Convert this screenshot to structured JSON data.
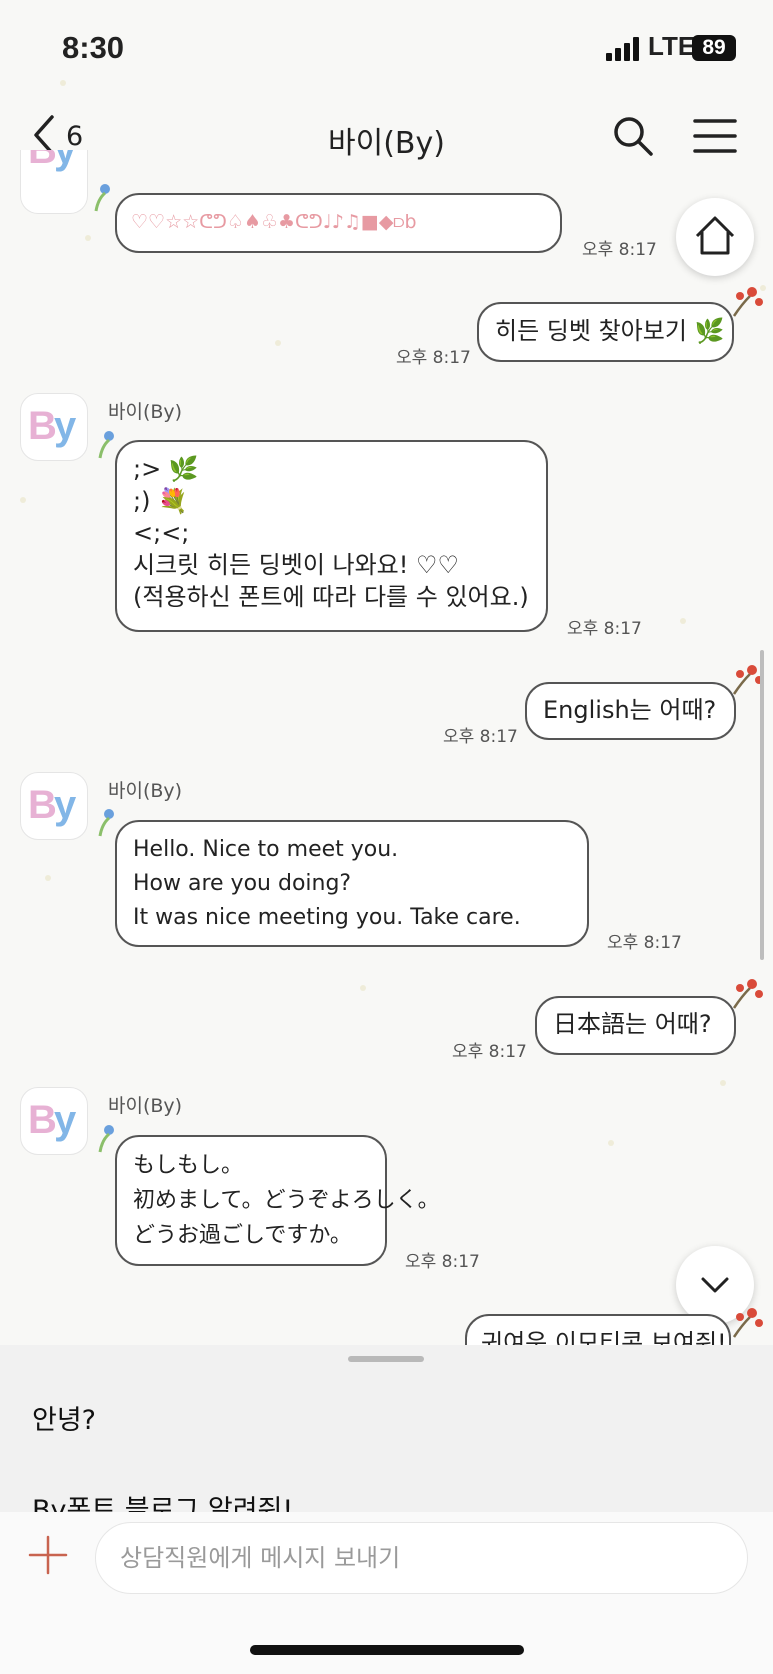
{
  "status_bar": {
    "time": "8:30",
    "network": "LTE",
    "battery": "89"
  },
  "header": {
    "back_count": "6",
    "title": "바이(By)"
  },
  "messages": [
    {
      "side": "left",
      "text": "♡♡☆☆ᕦᕤ♤♠♧♣ᕦᕤ♩♪♫■◆⫐b",
      "time": "오후 8:17"
    },
    {
      "side": "right",
      "text": "히든 딩벳 찾아보기 🌿",
      "time": "오후 8:17"
    },
    {
      "side": "left",
      "sender": "바이(By)",
      "text": ";> 🌿\n;) 💐\n<;<;\n시크릿 히든 딩벳이 나와요! ♡♡\n(적용하신 폰트에 따라 다를 수 있어요.)",
      "time": "오후 8:17"
    },
    {
      "side": "right",
      "text": "English는 어때?",
      "time": "오후 8:17"
    },
    {
      "side": "left",
      "sender": "바이(By)",
      "text": "Hello. Nice to meet you.\nHow are you doing?\nIt was nice meeting you. Take care.",
      "time": "오후 8:17"
    },
    {
      "side": "right",
      "text": "日本語는 어때?",
      "time": "오후 8:17"
    },
    {
      "side": "left",
      "sender": "바이(By)",
      "text": "もしもし。\n初めまして。どうぞよろしく。\nどうお過ごしですか。",
      "time": "오후 8:17"
    },
    {
      "side": "right",
      "text": "귀여운 이모티콘 보여줘!",
      "time": ""
    }
  ],
  "avatar_label": "By",
  "suggestions": [
    "안녕?",
    "By폰트 블로그 알려줘!"
  ],
  "input": {
    "placeholder": "상담직원에게 메시지 보내기"
  },
  "icons": {
    "back": "chevron-left-icon",
    "search": "search-icon",
    "menu": "hamburger-icon",
    "home": "home-icon",
    "down": "chevron-down-icon",
    "plus": "plus-icon"
  },
  "colors": {
    "accent_plus": "#c8634f",
    "bubble_border": "#555555",
    "background": "#f8f8f6"
  }
}
